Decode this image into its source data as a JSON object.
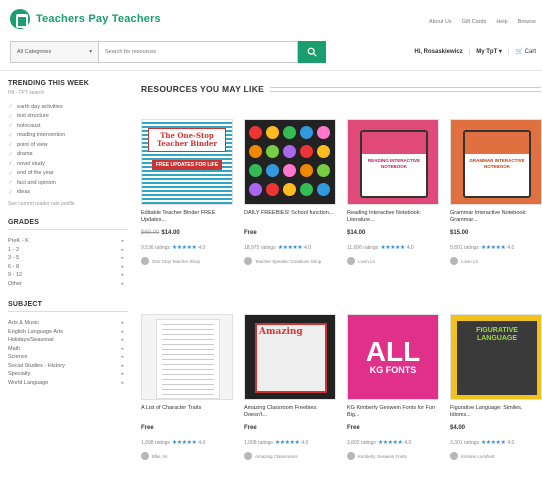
{
  "header": {
    "logo_text": "Teachers Pay Teachers",
    "links": [
      "About Us",
      "Gift Cards",
      "Help",
      "Browse"
    ],
    "category_select": "All Categories",
    "search_placeholder": "Search for resources",
    "user_name": "Hi, Rosaskiewicz",
    "my_tpt": "My TpT",
    "cart": "Cart"
  },
  "sidebar": {
    "trending_heading": "TRENDING THIS WEEK",
    "trending_sub": "Hit - TPT search",
    "trending": [
      "earth day activities",
      "text structure",
      "holocaust",
      "reading intervention",
      "point of view",
      "drama",
      "novel study",
      "end of the year",
      "fact and opinion",
      "ideas"
    ],
    "view_link": "See current reader rate profile",
    "grades_heading": "GRADES",
    "grades": [
      "PreK - K",
      "1 - 2",
      "3 - 5",
      "6 - 8",
      "9 - 12",
      "Other"
    ],
    "subject_heading": "SUBJECT",
    "subjects": [
      "Arts & Music",
      "English Language Arts",
      "Holidays/Seasonal",
      "Math",
      "Science",
      "Social Studies - History",
      "Specialty",
      "World Language"
    ]
  },
  "main": {
    "heading": "RESOURCES YOU MAY LIKE",
    "cards": [
      {
        "title": "Editable Teacher Binder FREE Updates...",
        "old_price": "$69.00",
        "price": "$14.00",
        "rating_count": "9,536 ratings",
        "stars": "★★★★★",
        "score": "4.0",
        "seller": "One Stop Teacher Shop",
        "thumb": "The One-Stop Teacher Binder",
        "thumb_sub": "FREE UPDATES FOR LIFE"
      },
      {
        "title": "DAILY FREEBIES! School function...",
        "old_price": "",
        "price": "Free",
        "rating_count": "18,975 ratings",
        "stars": "★★★★★",
        "score": "4.0",
        "seller": "Teacher Speaker Creations Shop",
        "thumb": "",
        "thumb_sub": ""
      },
      {
        "title": "Reading Interactive Notebook: Literature...",
        "old_price": "",
        "price": "$14.00",
        "rating_count": "11,006 ratings",
        "stars": "★★★★★",
        "score": "4.0",
        "seller": "Lovin Lit",
        "thumb": "READING INTERACTIVE NOTEBOOK",
        "thumb_sub": ""
      },
      {
        "title": "Grammar Interactive Notebook: Grammar...",
        "old_price": "",
        "price": "$15.00",
        "rating_count": "9,891 ratings",
        "stars": "★★★★★",
        "score": "4.0",
        "seller": "Lovin Lit",
        "thumb": "GRAMMAR INTERACTIVE NOTEBOOK",
        "thumb_sub": ""
      },
      {
        "title": "A List of Character Traits",
        "old_price": "",
        "price": "Free",
        "rating_count": "1,098 ratings",
        "stars": "★★★★★",
        "score": "4.0",
        "seller": "Ellie, M.",
        "thumb": "",
        "thumb_sub": ""
      },
      {
        "title": "Amazing Classroom Freebies: Doesn't...",
        "old_price": "",
        "price": "Free",
        "rating_count": "1,008 ratings",
        "stars": "★★★★★",
        "score": "4.0",
        "seller": "Amazing Classrooms",
        "thumb": "Amazing",
        "thumb_sub": ""
      },
      {
        "title": "KG Kimberly Geswein Fonts for Fun Big...",
        "old_price": "",
        "price": "Free",
        "rating_count": "3,802 ratings",
        "stars": "★★★★★",
        "score": "4.0",
        "seller": "Kimberly Geswein Fonts",
        "thumb": "ALL",
        "thumb_sub": "KG FONTS"
      },
      {
        "title": "Figurative Language: Similes, Idioms...",
        "old_price": "",
        "price": "$4.00",
        "rating_count": "3,301 ratings",
        "stars": "★★★★★",
        "score": "4.0",
        "seller": "Kristine Lockhart",
        "thumb": "FIGURATIVE LANGUAGE",
        "thumb_sub": ""
      }
    ]
  },
  "colors": {
    "brand": "#1a9e6e",
    "stars": "#3a8fd9"
  }
}
